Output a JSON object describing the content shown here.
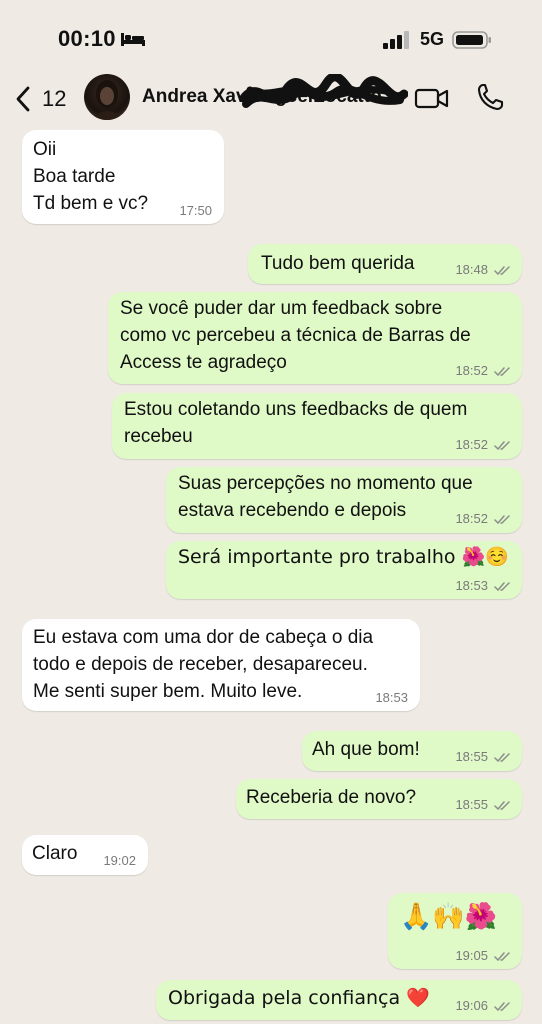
{
  "status_bar": {
    "time": "00:10",
    "network": "5G"
  },
  "header": {
    "back_count": "12",
    "contact_name": "Andrea Xavier gcelLocatto"
  },
  "messages": [
    {
      "dir": "in",
      "text": "Oii\nBoa tarde\nTd bem e vc?",
      "time": "17:50"
    },
    {
      "dir": "out",
      "text": "Tudo bem querida",
      "time": "18:48"
    },
    {
      "dir": "out",
      "text": "Se você puder dar um feedback sobre\ncomo vc percebeu a técnica de Barras de\nAccess te agradeço",
      "time": "18:52"
    },
    {
      "dir": "out",
      "text": "Estou coletando uns feedbacks de quem\nrecebeu",
      "time": "18:52"
    },
    {
      "dir": "out",
      "text": "Suas percepções no momento que\nestava recebendo e depois",
      "time": "18:52"
    },
    {
      "dir": "out",
      "text": "Será importante pro trabalho 🌺☺️",
      "time": "18:53"
    },
    {
      "dir": "in",
      "text": "Eu estava com uma dor de cabeça o dia\ntodo e depois de receber, desapareceu.\nMe senti super bem. Muito leve.",
      "time": "18:53"
    },
    {
      "dir": "out",
      "text": "Ah que bom!",
      "time": "18:55"
    },
    {
      "dir": "out",
      "text": "Receberia de novo?",
      "time": "18:55"
    },
    {
      "dir": "in",
      "text": "Claro",
      "time": "19:02"
    },
    {
      "dir": "out",
      "text": "🙏🙌🌺",
      "time": "19:05"
    },
    {
      "dir": "out",
      "text": "Obrigada pela confiança ❤️",
      "time": "19:06"
    }
  ],
  "icons": {
    "bed": "bed-icon",
    "signal": "signal-icon",
    "battery": "battery-icon",
    "back": "chevron-left-icon",
    "video": "video-camera-icon",
    "call": "phone-icon",
    "read": "double-check-icon"
  },
  "colors": {
    "background": "#efebe4",
    "incoming": "#ffffff",
    "outgoing": "#dff9c7",
    "read_ticks": "#8a8f8a"
  }
}
